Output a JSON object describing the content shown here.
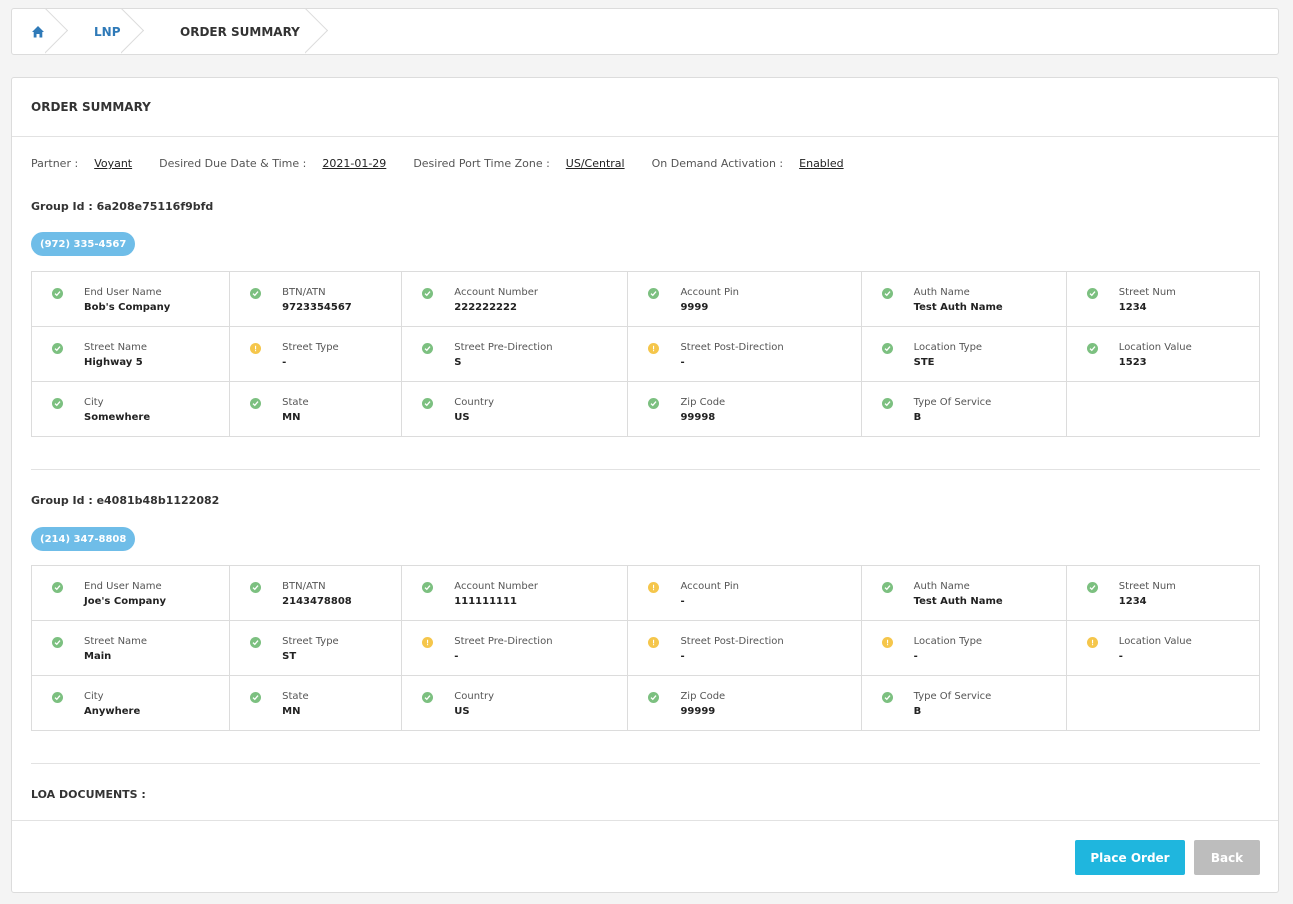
{
  "breadcrumb": {
    "home_icon": "home-icon",
    "items": [
      "LNP",
      "ORDER SUMMARY"
    ]
  },
  "panel": {
    "title": "ORDER SUMMARY"
  },
  "meta": {
    "partner_label": "Partner :",
    "partner_value": "Voyant",
    "due_label": "Desired Due Date & Time :",
    "due_value": "2021-01-29",
    "tz_label": "Desired Port Time Zone :",
    "tz_value": "US/Central",
    "ondemand_label": "On Demand Activation :",
    "ondemand_value": "Enabled"
  },
  "groups": [
    {
      "group_id": "Group Id : 6a208e75116f9bfd",
      "phone": "(972) 335-4567",
      "rows": [
        [
          {
            "status": "ok",
            "label": "End User Name",
            "value": "Bob's Company"
          },
          {
            "status": "ok",
            "label": "BTN/ATN",
            "value": "9723354567"
          },
          {
            "status": "ok",
            "label": "Account Number",
            "value": "222222222"
          },
          {
            "status": "ok",
            "label": "Account Pin",
            "value": "9999"
          },
          {
            "status": "ok",
            "label": "Auth Name",
            "value": "Test Auth Name"
          },
          {
            "status": "ok",
            "label": "Street Num",
            "value": "1234"
          }
        ],
        [
          {
            "status": "ok",
            "label": "Street Name",
            "value": "Highway 5"
          },
          {
            "status": "warn",
            "label": "Street Type",
            "value": "-"
          },
          {
            "status": "ok",
            "label": "Street Pre-Direction",
            "value": "S"
          },
          {
            "status": "warn",
            "label": "Street Post-Direction",
            "value": "-"
          },
          {
            "status": "ok",
            "label": "Location Type",
            "value": "STE"
          },
          {
            "status": "ok",
            "label": "Location Value",
            "value": "1523"
          }
        ],
        [
          {
            "status": "ok",
            "label": "City",
            "value": "Somewhere"
          },
          {
            "status": "ok",
            "label": "State",
            "value": "MN"
          },
          {
            "status": "ok",
            "label": "Country",
            "value": "US"
          },
          {
            "status": "ok",
            "label": "Zip Code",
            "value": "99998"
          },
          {
            "status": "ok",
            "label": "Type Of Service",
            "value": "B"
          },
          null
        ]
      ]
    },
    {
      "group_id": "Group Id : e4081b48b1122082",
      "phone": "(214) 347-8808",
      "rows": [
        [
          {
            "status": "ok",
            "label": "End User Name",
            "value": "Joe's Company"
          },
          {
            "status": "ok",
            "label": "BTN/ATN",
            "value": "2143478808"
          },
          {
            "status": "ok",
            "label": "Account Number",
            "value": "111111111"
          },
          {
            "status": "warn",
            "label": "Account Pin",
            "value": "-"
          },
          {
            "status": "ok",
            "label": "Auth Name",
            "value": "Test Auth Name"
          },
          {
            "status": "ok",
            "label": "Street Num",
            "value": "1234"
          }
        ],
        [
          {
            "status": "ok",
            "label": "Street Name",
            "value": "Main"
          },
          {
            "status": "ok",
            "label": "Street Type",
            "value": "ST"
          },
          {
            "status": "warn",
            "label": "Street Pre-Direction",
            "value": "-"
          },
          {
            "status": "warn",
            "label": "Street Post-Direction",
            "value": "-"
          },
          {
            "status": "warn",
            "label": "Location Type",
            "value": "-"
          },
          {
            "status": "warn",
            "label": "Location Value",
            "value": "-"
          }
        ],
        [
          {
            "status": "ok",
            "label": "City",
            "value": "Anywhere"
          },
          {
            "status": "ok",
            "label": "State",
            "value": "MN"
          },
          {
            "status": "ok",
            "label": "Country",
            "value": "US"
          },
          {
            "status": "ok",
            "label": "Zip Code",
            "value": "99999"
          },
          {
            "status": "ok",
            "label": "Type Of Service",
            "value": "B"
          },
          null
        ]
      ]
    }
  ],
  "loa": {
    "label": "LOA DOCUMENTS :"
  },
  "actions": {
    "place_order": "Place Order",
    "back": "Back"
  },
  "colors": {
    "ok": "#7cc080",
    "warn": "#f5c64b",
    "pill": "#6fbde8",
    "primary": "#1fb6de",
    "secondary": "#bdbdbd",
    "link": "#2f7ab8"
  }
}
